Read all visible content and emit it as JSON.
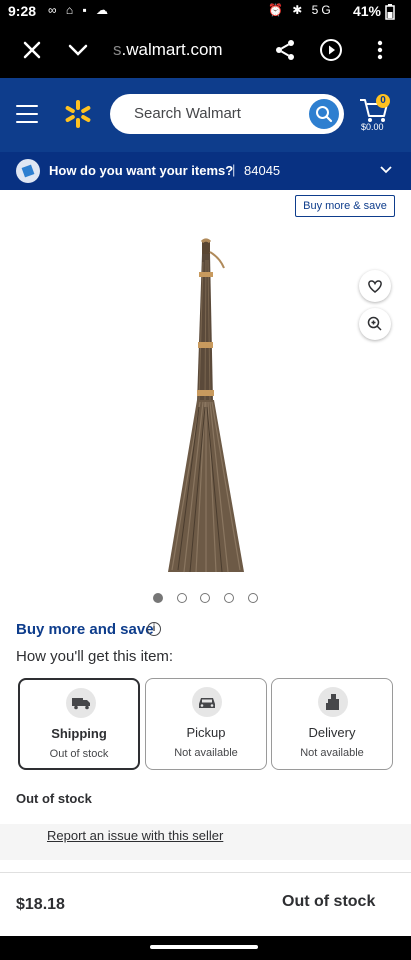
{
  "status_bar": {
    "time": "9:28",
    "left_icons": "∞ ⌂ ▪ ☁",
    "right_icons": "⏰ ✱ 5G",
    "battery": "41%"
  },
  "browser": {
    "url_fade": "s",
    "url": ".walmart.com"
  },
  "header": {
    "search_placeholder": "Search Walmart",
    "cart_count": "0",
    "cart_total": "$0.00",
    "brand_color": "#0e3d8c"
  },
  "delivery": {
    "question": "How do you want your items?",
    "separator": "|",
    "zip": "84045"
  },
  "product": {
    "buy_more_chip": "Buy more & save",
    "image_count": 5,
    "active_image": 0
  },
  "fulfillment": {
    "buy_more_link": "Buy more and save",
    "info_glyph": "i",
    "how_get": "How you'll get this item:",
    "options": [
      {
        "title": "Shipping",
        "sub": "Out of stock",
        "icon": "truck-icon"
      },
      {
        "title": "Pickup",
        "sub": "Not available",
        "icon": "car-icon"
      },
      {
        "title": "Delivery",
        "sub": "Not available",
        "icon": "bag-icon"
      }
    ],
    "stock_label": "Out of stock",
    "report_link": "Report an issue with this seller"
  },
  "bottom": {
    "price": "$18.18",
    "status": "Out of stock"
  }
}
